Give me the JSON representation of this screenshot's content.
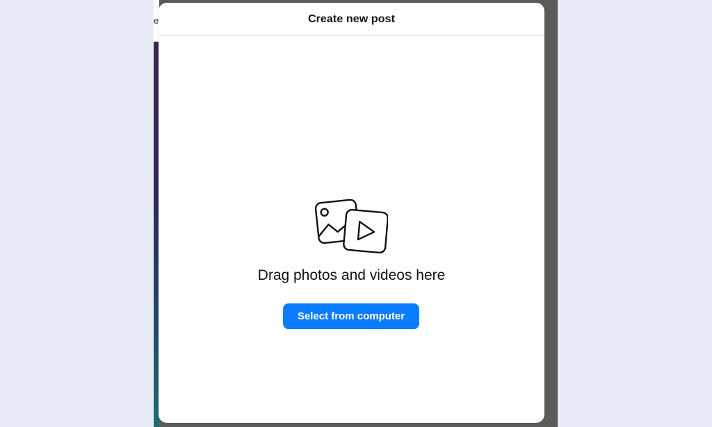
{
  "modal": {
    "title": "Create new post",
    "drag_text": "Drag photos and videos here",
    "select_button_label": "Select from computer",
    "icon": "photo-video-icon"
  },
  "background": {
    "partial_text": "e"
  },
  "colors": {
    "page_background": "#e8edf7",
    "overlay": "#5b5b5b",
    "button_primary": "#0a7cff",
    "modal_background": "#ffffff"
  }
}
